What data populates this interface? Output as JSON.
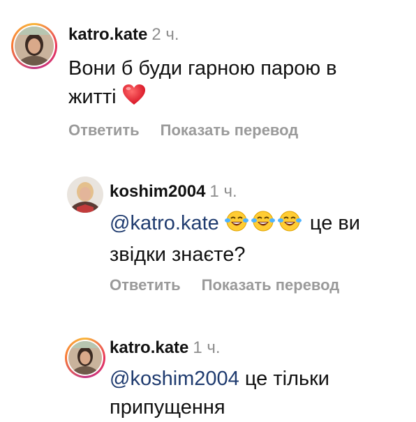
{
  "comments": [
    {
      "username": "katro.kate",
      "time": "2 ч.",
      "text_line1": "Вони б буди гарною парою в",
      "text_line2": "житті",
      "emoji_names": [
        "red-heart-icon"
      ],
      "reply_label": "Ответить",
      "translate_label": "Показать перевод"
    },
    {
      "username": "koshim2004",
      "time": "1 ч.",
      "mention": "@katro.kate",
      "text_after_emojis": "це ви",
      "text_line2": "звідки знаєте?",
      "emoji_names": [
        "face-with-tears-of-joy-icon",
        "face-with-tears-of-joy-icon",
        "face-with-tears-of-joy-icon"
      ],
      "reply_label": "Ответить",
      "translate_label": "Показать перевод"
    },
    {
      "username": "katro.kate",
      "time": "1 ч.",
      "mention": "@koshim2004",
      "text_line1": "це тільки",
      "text_line2": "припущення"
    }
  ],
  "colors": {
    "mention": "#1f3b6f",
    "secondary_text": "#8e8e8e",
    "action_text": "#9a9a9a",
    "story_ring_start": "#f9b63b",
    "story_ring_end": "#c13584"
  }
}
